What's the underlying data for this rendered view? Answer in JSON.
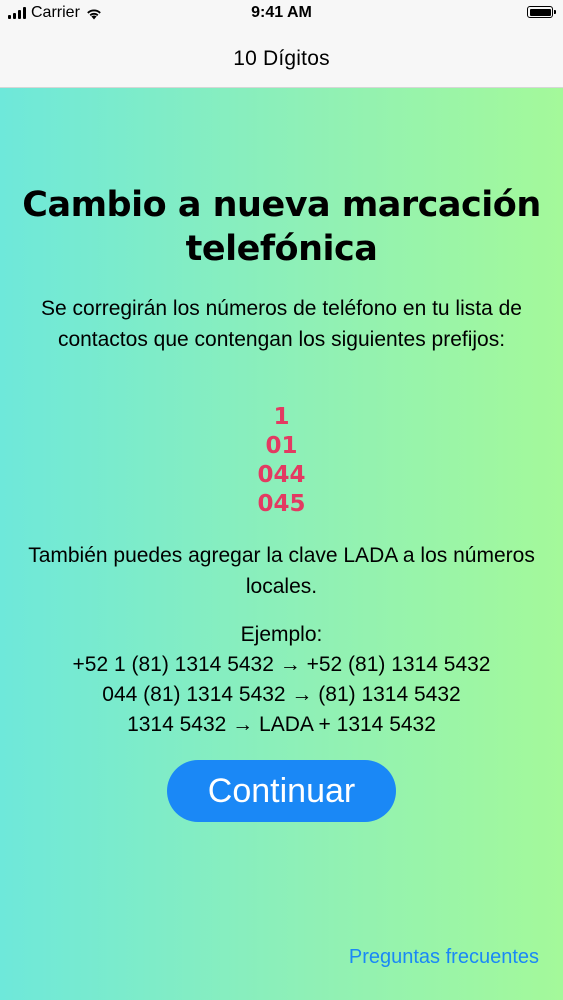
{
  "status_bar": {
    "carrier": "Carrier",
    "time": "9:41 AM",
    "icons": [
      "cellular-signal-icon",
      "wifi-icon",
      "battery-icon"
    ]
  },
  "nav": {
    "title": "10 Dígitos"
  },
  "main": {
    "title": "Cambio a nueva marcación telefónica",
    "description": "Se corregirán los números de teléfono en tu lista de contactos que contengan los siguientes prefijos:",
    "prefixes": [
      "1",
      "01",
      "044",
      "045"
    ],
    "lada_text": "También puedes agregar la clave LADA a los números locales.",
    "example_label": "Ejemplo:",
    "examples": [
      "+52 1 (81) 1314 5432 → +52 (81) 1314 5432",
      "044 (81) 1314 5432 → (81) 1314 5432",
      "1314 5432 → LADA + 1314 5432"
    ],
    "continue_label": "Continuar",
    "faq_link": "Preguntas frecuentes"
  },
  "colors": {
    "accent": "#1a88f6",
    "prefix": "#e33a62",
    "gradient_start": "#6ee8da",
    "gradient_end": "#a4f99a"
  }
}
